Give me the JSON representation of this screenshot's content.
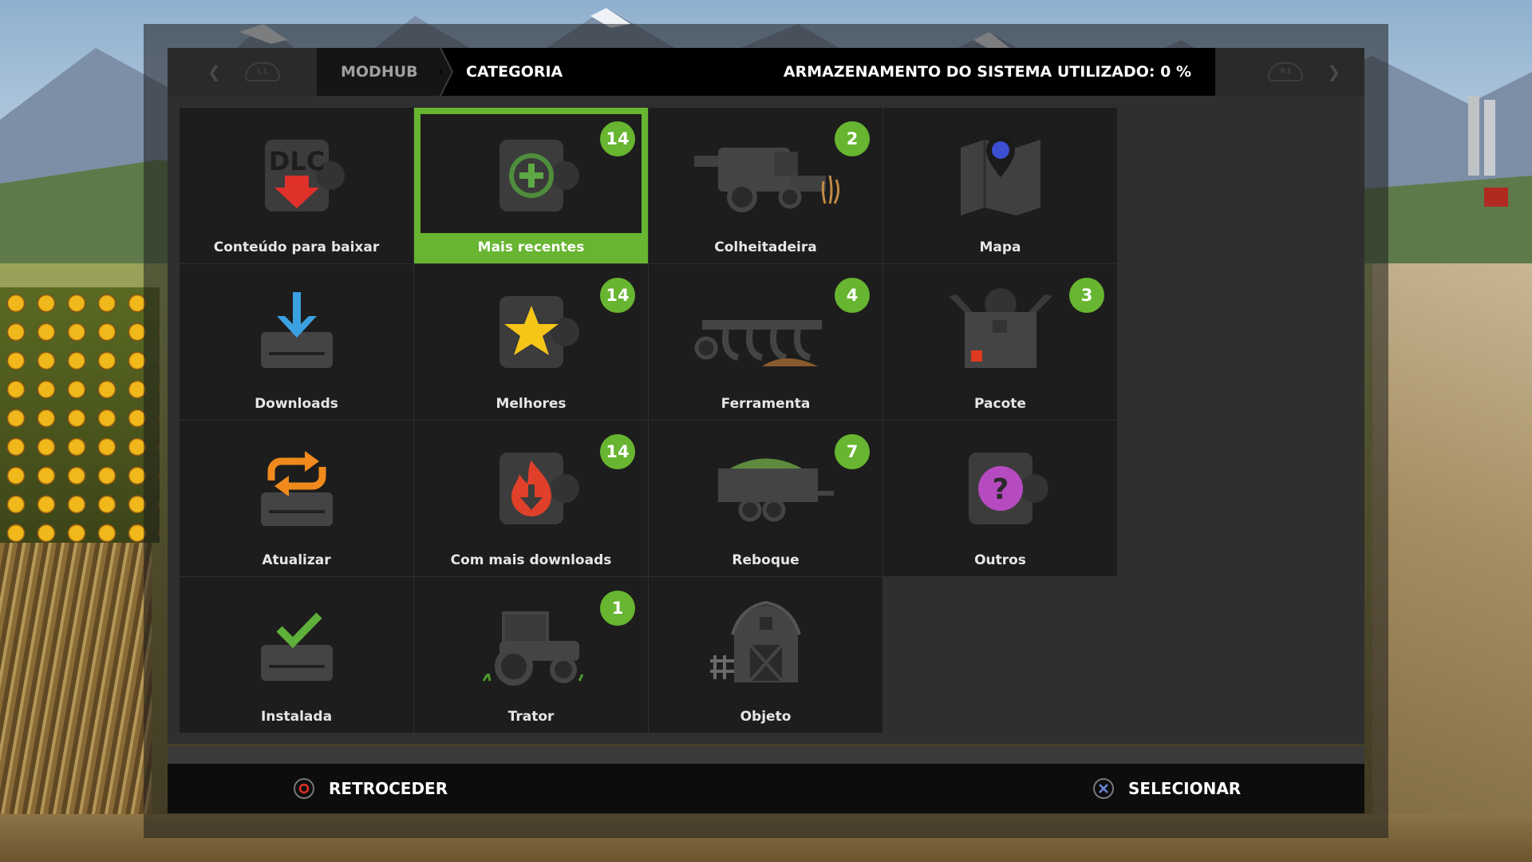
{
  "header": {
    "breadcrumb_root": "MODHUB",
    "breadcrumb_current": "CATEGORIA",
    "storage_label": "ARMAZENAMENTO DO SISTEMA UTILIZADO: 0 %",
    "left_shoulder": "L1",
    "right_shoulder": "R1"
  },
  "tiles": [
    {
      "label": "Conteúdo para baixar",
      "icon": "dlc-icon",
      "badge": ""
    },
    {
      "label": "Mais recentes",
      "icon": "new-plus-icon",
      "badge": "14",
      "selected": true
    },
    {
      "label": "Colheitadeira",
      "icon": "harvester-icon",
      "badge": "2"
    },
    {
      "label": "Mapa",
      "icon": "map-pin-icon",
      "badge": ""
    },
    {
      "label": "Downloads",
      "icon": "download-arrow-icon",
      "badge": ""
    },
    {
      "label": "Melhores",
      "icon": "star-icon",
      "badge": "14"
    },
    {
      "label": "Ferramenta",
      "icon": "plow-tool-icon",
      "badge": "4"
    },
    {
      "label": "Pacote",
      "icon": "package-box-icon",
      "badge": "3"
    },
    {
      "label": "Atualizar",
      "icon": "update-arrows-icon",
      "badge": ""
    },
    {
      "label": "Com mais downloads",
      "icon": "hot-download-icon",
      "badge": "14"
    },
    {
      "label": "Reboque",
      "icon": "trailer-icon",
      "badge": "7"
    },
    {
      "label": "Outros",
      "icon": "question-icon",
      "badge": ""
    },
    {
      "label": "Instalada",
      "icon": "installed-check-icon",
      "badge": ""
    },
    {
      "label": "Trator",
      "icon": "tractor-icon",
      "badge": "1"
    },
    {
      "label": "Objeto",
      "icon": "barn-icon",
      "badge": ""
    }
  ],
  "footer": {
    "back_label": "RETROCEDER",
    "select_label": "SELECIONAR"
  },
  "colors": {
    "accent_green": "#67b530",
    "tile_bg": "#1d1d1d",
    "panel_bg": "#2f2f2f"
  }
}
